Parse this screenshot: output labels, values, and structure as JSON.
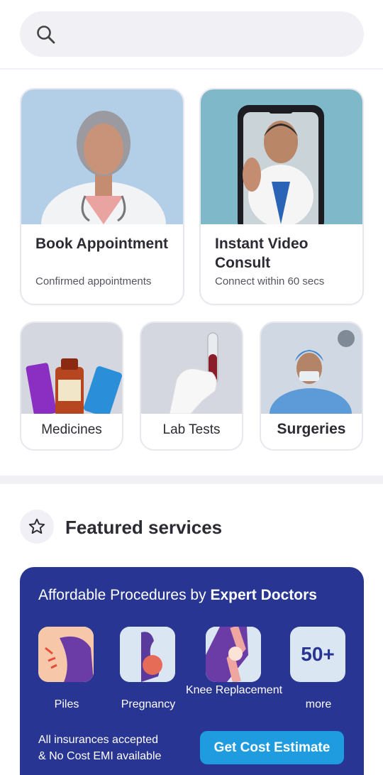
{
  "search": {
    "icon": "search-icon"
  },
  "cards": [
    {
      "title": "Book Appointment",
      "subtitle": "Confirmed appointments",
      "image": "doctor-portrait"
    },
    {
      "title": "Instant Video Consult",
      "subtitle": "Connect within 60 secs",
      "image": "doctor-on-phone"
    }
  ],
  "tiles": [
    {
      "label": "Medicines",
      "image": "medicine-bottles"
    },
    {
      "label": "Lab Tests",
      "image": "blood-sample-tube"
    },
    {
      "label": "Surgeries",
      "image": "surgeon"
    }
  ],
  "featured": {
    "icon": "star-icon",
    "title": "Featured services"
  },
  "banner": {
    "title_prefix": "Affordable Procedures by ",
    "title_bold": "Expert Doctors",
    "procedures": [
      {
        "label": "Piles"
      },
      {
        "label": "Pregnancy"
      },
      {
        "label": "Knee Replacement"
      },
      {
        "tile_text": "50+",
        "label": "more"
      }
    ],
    "footer_line1": "All insurances accepted",
    "footer_line2": "& No Cost EMI available",
    "cta": "Get Cost Estimate"
  },
  "colors": {
    "accent": "#283593",
    "cta": "#1f9be0",
    "card_bg1": "#b3cfe8",
    "card_bg2": "#7eb8c9"
  }
}
